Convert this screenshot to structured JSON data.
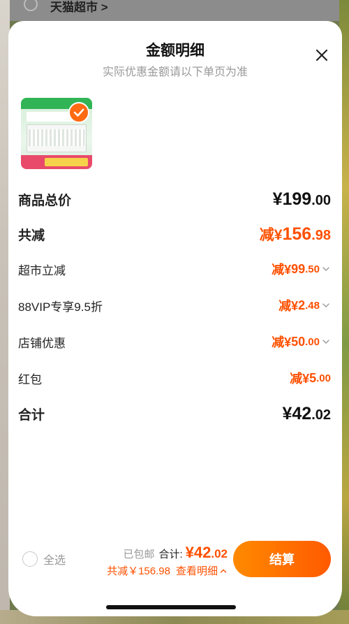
{
  "background": {
    "store_name": "天猫超市 >"
  },
  "sheet": {
    "title": "金额明细",
    "subtitle": "实际优惠金额请以下单页为准"
  },
  "rows": {
    "goods_total": {
      "label": "商品总价",
      "currency": "¥",
      "integer": "199",
      "cents": ".00"
    },
    "total_reduce": {
      "label": "共减",
      "prefix": "减¥",
      "integer": "156",
      "cents": ".98"
    },
    "items": [
      {
        "label": "超市立减",
        "prefix": "减¥",
        "integer": "99",
        "cents": ".50",
        "expandable": true
      },
      {
        "label": "88VIP专享9.5折",
        "prefix": "减¥",
        "integer": "2",
        "cents": ".48",
        "expandable": true
      },
      {
        "label": "店铺优惠",
        "prefix": "减¥",
        "integer": "50",
        "cents": ".00",
        "expandable": true
      },
      {
        "label": "红包",
        "prefix": "减¥",
        "integer": "5",
        "cents": ".00",
        "expandable": false
      }
    ],
    "sum": {
      "label": "合计",
      "currency": "¥",
      "integer": "42",
      "cents": ".02"
    }
  },
  "bottom_bar": {
    "select_all": "全选",
    "free_shipping": "已包邮",
    "sum_label": "合计:",
    "sum_currency": "¥",
    "sum_integer": "42",
    "sum_cents": ".02",
    "reduce_text": "共减￥156.98",
    "detail_link": "查看明细",
    "checkout": "结算"
  },
  "colors": {
    "accent": "#ff5000",
    "checkout_gradient_start": "#ff8a00",
    "checkout_gradient_end": "#ff5a00"
  },
  "icons": {
    "close": "close-icon",
    "chevron": "chevron-down-icon",
    "check": "check-icon",
    "caret_up": "chevron-up-icon"
  }
}
